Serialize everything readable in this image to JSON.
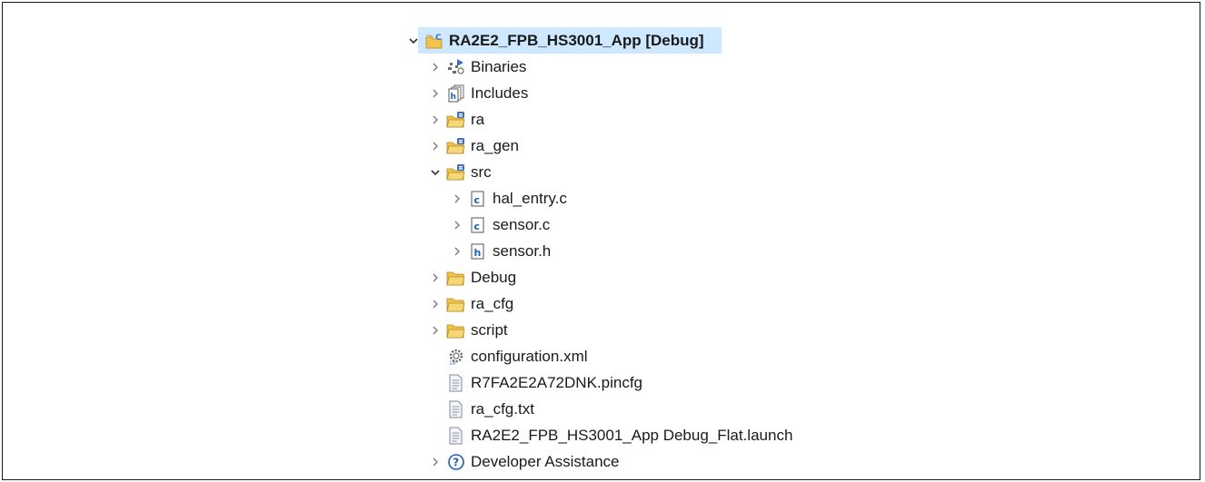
{
  "tree": {
    "root": {
      "label": "RA2E2_FPB_HS3001_App [Debug]",
      "icon": "c-project-icon",
      "expanded": true
    },
    "items": [
      {
        "label": "Binaries",
        "icon": "binaries-icon",
        "toggle": "collapsed",
        "level": 1
      },
      {
        "label": "Includes",
        "icon": "includes-icon",
        "toggle": "collapsed",
        "level": 1
      },
      {
        "label": "ra",
        "icon": "source-folder-icon",
        "toggle": "collapsed",
        "level": 1
      },
      {
        "label": "ra_gen",
        "icon": "source-folder-icon",
        "toggle": "collapsed",
        "level": 1
      },
      {
        "label": "src",
        "icon": "source-folder-icon",
        "toggle": "expanded",
        "level": 1
      },
      {
        "label": "hal_entry.c",
        "icon": "c-file-icon",
        "toggle": "collapsed",
        "level": 2
      },
      {
        "label": "sensor.c",
        "icon": "c-file-icon",
        "toggle": "collapsed",
        "level": 2
      },
      {
        "label": "sensor.h",
        "icon": "h-file-icon",
        "toggle": "collapsed",
        "level": 2
      },
      {
        "label": "Debug",
        "icon": "folder-icon",
        "toggle": "collapsed",
        "level": 1
      },
      {
        "label": "ra_cfg",
        "icon": "folder-icon",
        "toggle": "collapsed",
        "level": 1
      },
      {
        "label": "script",
        "icon": "folder-icon",
        "toggle": "collapsed",
        "level": 1
      },
      {
        "label": "configuration.xml",
        "icon": "config-gear-icon",
        "toggle": "none",
        "level": 1
      },
      {
        "label": "R7FA2E2A72DNK.pincfg",
        "icon": "text-file-icon",
        "toggle": "none",
        "level": 1
      },
      {
        "label": "ra_cfg.txt",
        "icon": "text-file-icon",
        "toggle": "none",
        "level": 1
      },
      {
        "label": "RA2E2_FPB_HS3001_App Debug_Flat.launch",
        "icon": "text-file-icon",
        "toggle": "none",
        "level": 1
      },
      {
        "label": "Developer Assistance",
        "icon": "help-circle-icon",
        "toggle": "collapsed",
        "level": 1
      }
    ]
  },
  "colors": {
    "selection": "#cde8ff",
    "folder": "#f0c44a",
    "source_badge": "#3f6fc9",
    "c_letter": "#1f5fb4",
    "help": "#1f5fb4"
  }
}
